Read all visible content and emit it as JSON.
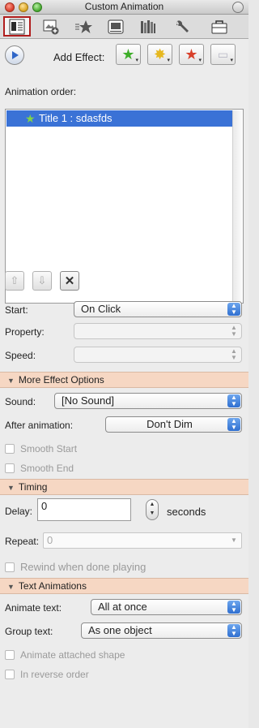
{
  "window": {
    "title": "Custom Animation"
  },
  "tabs": [
    {
      "icon": "document-properties-icon",
      "selected": true
    },
    {
      "icon": "image-add-icon",
      "selected": false
    },
    {
      "icon": "custom-animation-star-icon",
      "selected": false
    },
    {
      "icon": "media-browser-icon",
      "selected": false
    },
    {
      "icon": "library-books-icon",
      "selected": false
    },
    {
      "icon": "tools-wrench-icon",
      "selected": false
    },
    {
      "icon": "toolbox-icon",
      "selected": false
    }
  ],
  "add_effect": {
    "play_icon": "play-icon",
    "label": "Add Effect:",
    "buttons": [
      {
        "icon": "entrance-effect-icon",
        "color": "#3fae2a"
      },
      {
        "icon": "emphasis-effect-icon",
        "color": "#e6b820"
      },
      {
        "icon": "exit-effect-icon",
        "color": "#d8402a"
      },
      {
        "icon": "motion-path-icon",
        "color": "#b9b9c6"
      }
    ]
  },
  "animation_order": {
    "label": "Animation order:",
    "items": [
      {
        "label": "Title 1 : sdasfds",
        "selected": true
      }
    ]
  },
  "order_buttons": [
    {
      "icon": "move-up-icon"
    },
    {
      "icon": "move-down-icon"
    },
    {
      "icon": "delete-icon"
    }
  ],
  "start": {
    "label": "Start:",
    "value": "On Click"
  },
  "property": {
    "label": "Property:",
    "value": ""
  },
  "speed": {
    "label": "Speed:",
    "value": ""
  },
  "more_effect": {
    "header": "More Effect Options",
    "sound_label": "Sound:",
    "sound_value": "[No Sound]",
    "after_label": "After animation:",
    "after_value": "Don't Dim",
    "smooth_start": "Smooth Start",
    "smooth_end": "Smooth End"
  },
  "timing": {
    "header": "Timing",
    "delay_label": "Delay:",
    "delay_value": "0",
    "seconds_label": "seconds",
    "repeat_label": "Repeat:",
    "repeat_value": "0",
    "rewind": "Rewind when done playing"
  },
  "text_animations": {
    "header": "Text Animations",
    "animate_label": "Animate text:",
    "animate_value": "All at once",
    "group_label": "Group text:",
    "group_value": "As one object",
    "attached_shape": "Animate attached shape",
    "reverse_order": "In reverse order"
  },
  "colors": {
    "selection": "#3a72d6",
    "section_header": "#f6d7c3",
    "selected_tab_border": "#b01d1d"
  }
}
